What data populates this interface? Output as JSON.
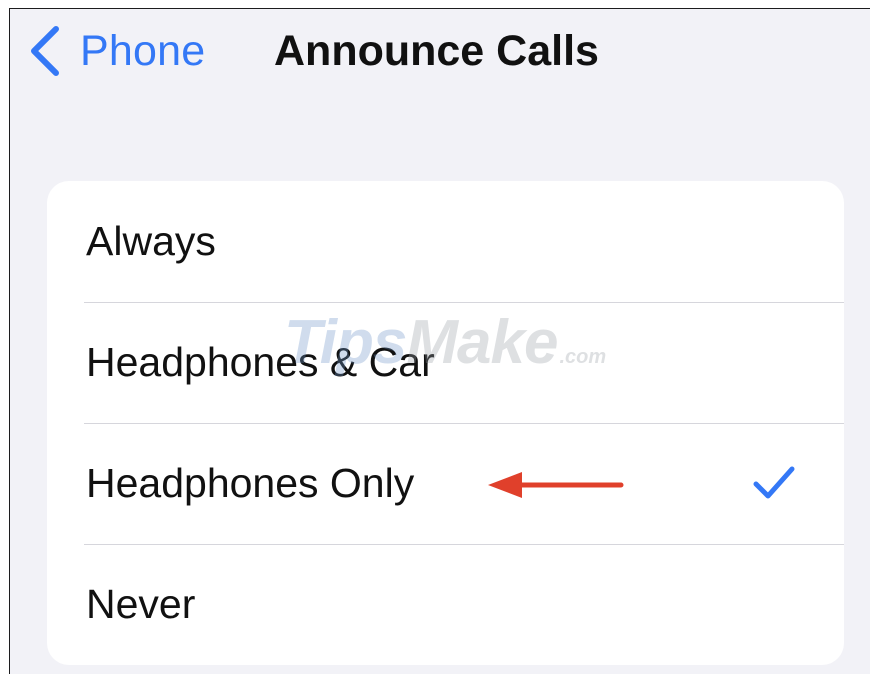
{
  "nav": {
    "back_label": "Phone",
    "back_icon": "chevron-left-icon",
    "title": "Announce Calls"
  },
  "options": [
    {
      "label": "Always",
      "selected": false
    },
    {
      "label": "Headphones & Car",
      "selected": false
    },
    {
      "label": "Headphones Only",
      "selected": true
    },
    {
      "label": "Never",
      "selected": false
    }
  ],
  "selected_icon": "checkmark-icon",
  "annotation": {
    "icon": "arrow-left-icon",
    "color": "#e0402b"
  },
  "watermark": {
    "brand_a": "Tips",
    "brand_b": "Make",
    "suffix": ".com"
  },
  "colors": {
    "accent": "#3478f6",
    "background": "#f2f2f7",
    "card": "#ffffff",
    "separator": "#d6d6dc",
    "text": "#111111"
  }
}
